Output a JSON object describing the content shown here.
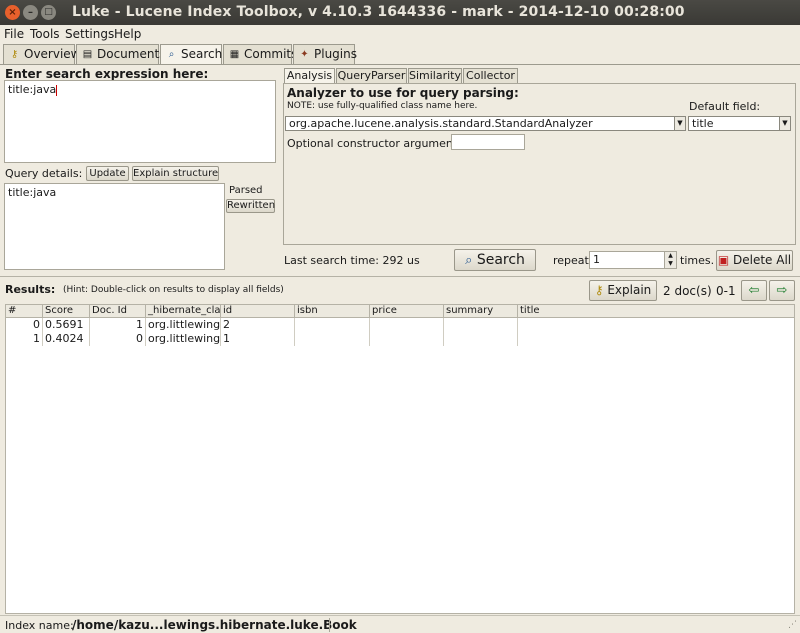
{
  "window": {
    "title": "Luke - Lucene Index Toolbox, v 4.10.3 1644336 - mark - 2014-12-10 00:28:00"
  },
  "menu": [
    "File",
    "Tools",
    "Settings",
    "Help"
  ],
  "tabs": [
    "Overview",
    "Documents",
    "Search",
    "Commits",
    "Plugins"
  ],
  "search": {
    "label": "Enter search expression here:",
    "expression": "title:java",
    "query_details_label": "Query details:",
    "update_button": "Update",
    "explain_structure_button": "Explain structure",
    "parsed_query": "title:java",
    "parsed_label": "Parsed",
    "rewritten_label": "Rewritten"
  },
  "analysis": {
    "tabs": [
      "Analysis",
      "QueryParser",
      "Similarity",
      "Collector"
    ],
    "heading": "Analyzer to use for query parsing:",
    "note": "NOTE: use fully-qualified class name here.",
    "default_field_label": "Default field:",
    "analyzer": "org.apache.lucene.analysis.standard.StandardAnalyzer",
    "default_field": "title",
    "constructor_label": "Optional constructor argument:",
    "constructor_value": ""
  },
  "run": {
    "last_search_time": "Last search time: 292 us",
    "search_button": "Search",
    "repeat_label": "repeat",
    "repeat_value": "1",
    "times_label": "times.",
    "delete_all_button": "Delete All"
  },
  "results": {
    "label": "Results:",
    "hint": "(Hint: Double-click on results to display all fields)",
    "explain_button": "Explain",
    "doc_count": "2 doc(s)",
    "range": "0-1",
    "columns": [
      "#",
      "Score",
      "Doc. Id",
      "_hibernate_cla",
      "id",
      "isbn",
      "price",
      "summary",
      "title"
    ],
    "rows": [
      [
        "0",
        "0.5691",
        "1",
        "org.littlewing",
        "2",
        "",
        "",
        "",
        ""
      ],
      [
        "1",
        "0.4024",
        "0",
        "org.littlewing",
        "1",
        "",
        "",
        "",
        ""
      ]
    ]
  },
  "status": {
    "index_name_label": "Index name:",
    "index_path": "/home/kazu...lewings.hibernate.luke.Book"
  },
  "colors": {
    "titlebar": "#3c3b37",
    "background": "#efebe0",
    "close": "#e8602c"
  }
}
